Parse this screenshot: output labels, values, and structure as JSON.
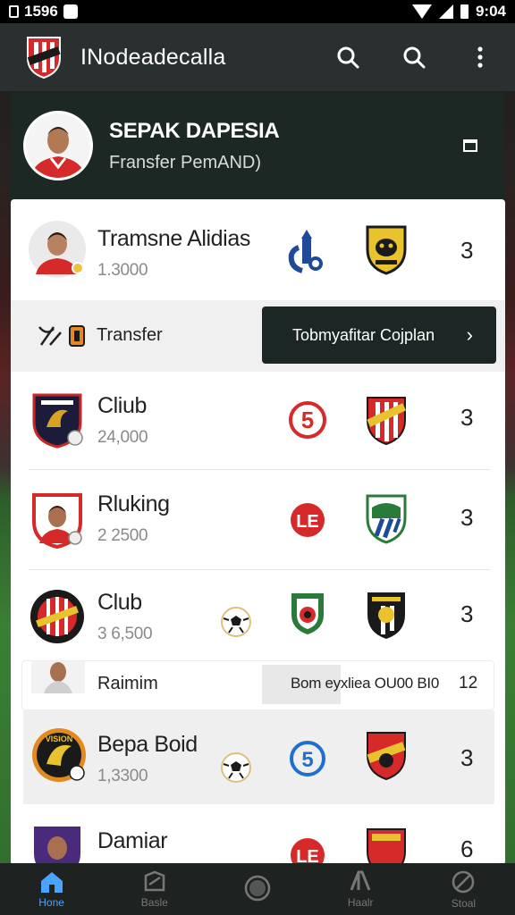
{
  "status_bar": {
    "time_left": "1596",
    "time_right": "9:04"
  },
  "app_bar": {
    "title": "INodeadecalla",
    "actions": [
      "search-icon",
      "search-icon",
      "more-vertical-icon"
    ]
  },
  "profile": {
    "name": "SEPAK DAPESIA",
    "subtitle": "Fransfer PemAND)"
  },
  "rows": [
    {
      "name": "Tramsne Alidias",
      "value": "1.3000",
      "count": "3"
    },
    {
      "name": "Cliub",
      "value": "24,000",
      "count": "3"
    },
    {
      "name": "Rluking",
      "value": "2 2500",
      "count": "3"
    },
    {
      "name": "Club",
      "value": "3 6,500",
      "count": "3"
    },
    {
      "name": "Bepa Boid",
      "value": "1,3300",
      "count": "3"
    },
    {
      "name": "Damiar",
      "value": "",
      "count": "6"
    }
  ],
  "transfer": {
    "label": "Transfer",
    "cta": "Tobmyafitar Cojplan",
    "cta_chevron": "›"
  },
  "compact_row": {
    "name": "Raimim",
    "value": "Bom eyxliea OU00 BI0",
    "count": "12"
  },
  "bottom_nav": [
    {
      "label": "Hone",
      "icon": "home-icon",
      "active": true
    },
    {
      "label": "Basle",
      "icon": "tag-icon",
      "active": false
    },
    {
      "label": "",
      "icon": "circle-icon",
      "active": false
    },
    {
      "label": "Haalr",
      "icon": "upload-icon",
      "active": false
    },
    {
      "label": "Stoal",
      "icon": "block-icon",
      "active": false
    }
  ],
  "colors": {
    "accent": "#4aa3ff",
    "app_bar": "#2a302f",
    "card_dark": "#1c2624",
    "club_red": "#d62a2a"
  }
}
